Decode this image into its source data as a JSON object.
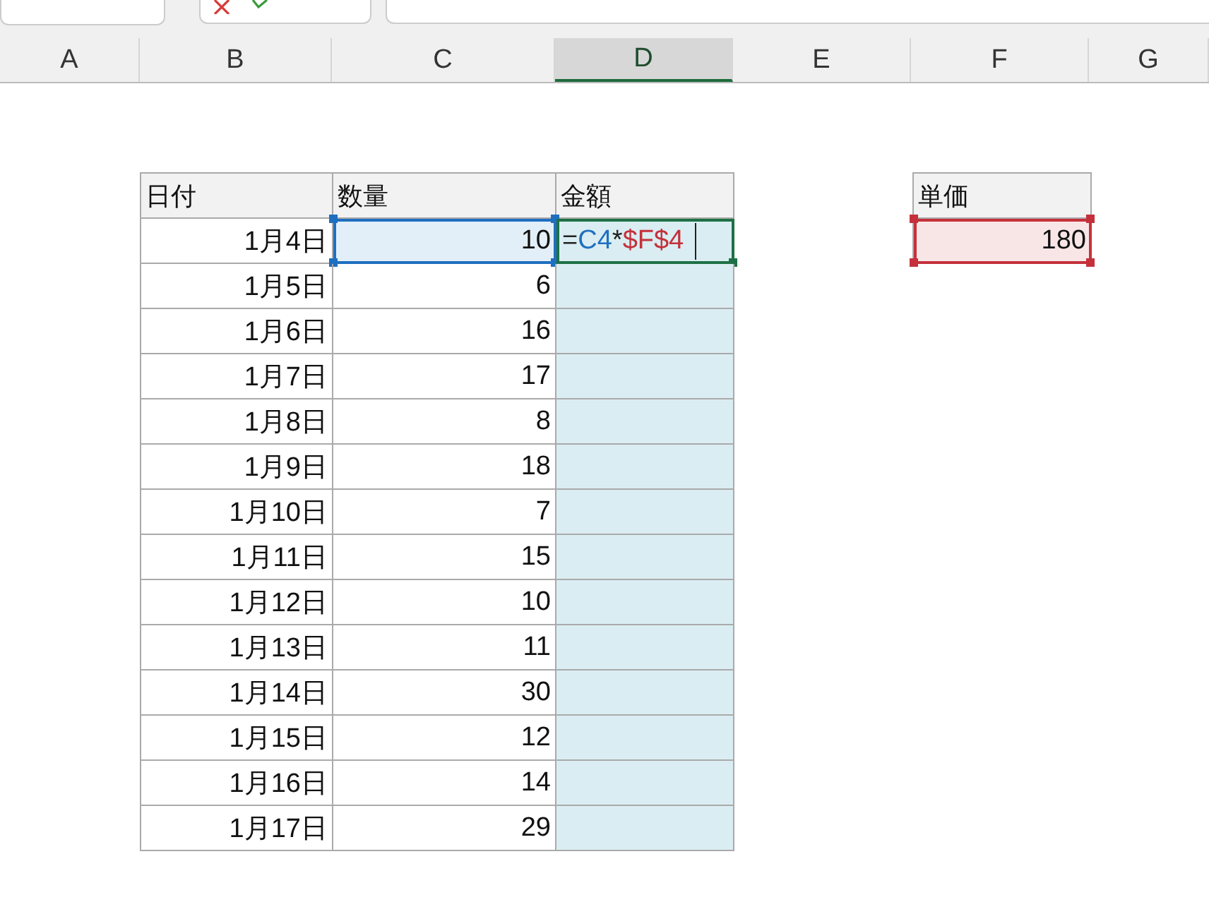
{
  "column_headers": [
    {
      "label": "A",
      "selected": false
    },
    {
      "label": "B",
      "selected": false
    },
    {
      "label": "C",
      "selected": false
    },
    {
      "label": "D",
      "selected": true
    },
    {
      "label": "E",
      "selected": false
    },
    {
      "label": "F",
      "selected": false
    },
    {
      "label": "G",
      "selected": false
    }
  ],
  "table": {
    "columns": [
      "日付",
      "数量",
      "金額"
    ],
    "rows": [
      {
        "date": "1月4日",
        "quantity": "10",
        "quantity_referenced": true,
        "amount_selected": true,
        "editing": true,
        "formula": [
          {
            "text": "=",
            "color": "#222222"
          },
          {
            "text": "C4",
            "color": "#1f6fc0"
          },
          {
            "text": "*",
            "color": "#222222"
          },
          {
            "text": "$F$4",
            "color": "#c4313b"
          }
        ]
      },
      {
        "date": "1月5日",
        "quantity": "6",
        "quantity_referenced": false,
        "amount_selected": true,
        "editing": false
      },
      {
        "date": "1月6日",
        "quantity": "16",
        "quantity_referenced": false,
        "amount_selected": true,
        "editing": false
      },
      {
        "date": "1月7日",
        "quantity": "17",
        "quantity_referenced": false,
        "amount_selected": true,
        "editing": false
      },
      {
        "date": "1月8日",
        "quantity": "8",
        "quantity_referenced": false,
        "amount_selected": true,
        "editing": false
      },
      {
        "date": "1月9日",
        "quantity": "18",
        "quantity_referenced": false,
        "amount_selected": true,
        "editing": false
      },
      {
        "date": "1月10日",
        "quantity": "7",
        "quantity_referenced": false,
        "amount_selected": true,
        "editing": false
      },
      {
        "date": "1月11日",
        "quantity": "15",
        "quantity_referenced": false,
        "amount_selected": true,
        "editing": false
      },
      {
        "date": "1月12日",
        "quantity": "10",
        "quantity_referenced": false,
        "amount_selected": true,
        "editing": false
      },
      {
        "date": "1月13日",
        "quantity": "11",
        "quantity_referenced": false,
        "amount_selected": true,
        "editing": false
      },
      {
        "date": "1月14日",
        "quantity": "30",
        "quantity_referenced": false,
        "amount_selected": true,
        "editing": false
      },
      {
        "date": "1月15日",
        "quantity": "12",
        "quantity_referenced": false,
        "amount_selected": true,
        "editing": false
      },
      {
        "date": "1月16日",
        "quantity": "14",
        "quantity_referenced": false,
        "amount_selected": true,
        "editing": false
      },
      {
        "date": "1月17日",
        "quantity": "29",
        "quantity_referenced": false,
        "amount_selected": true,
        "editing": false
      }
    ]
  },
  "unit_price": {
    "header": "単価",
    "value": "180",
    "referenced": true
  }
}
